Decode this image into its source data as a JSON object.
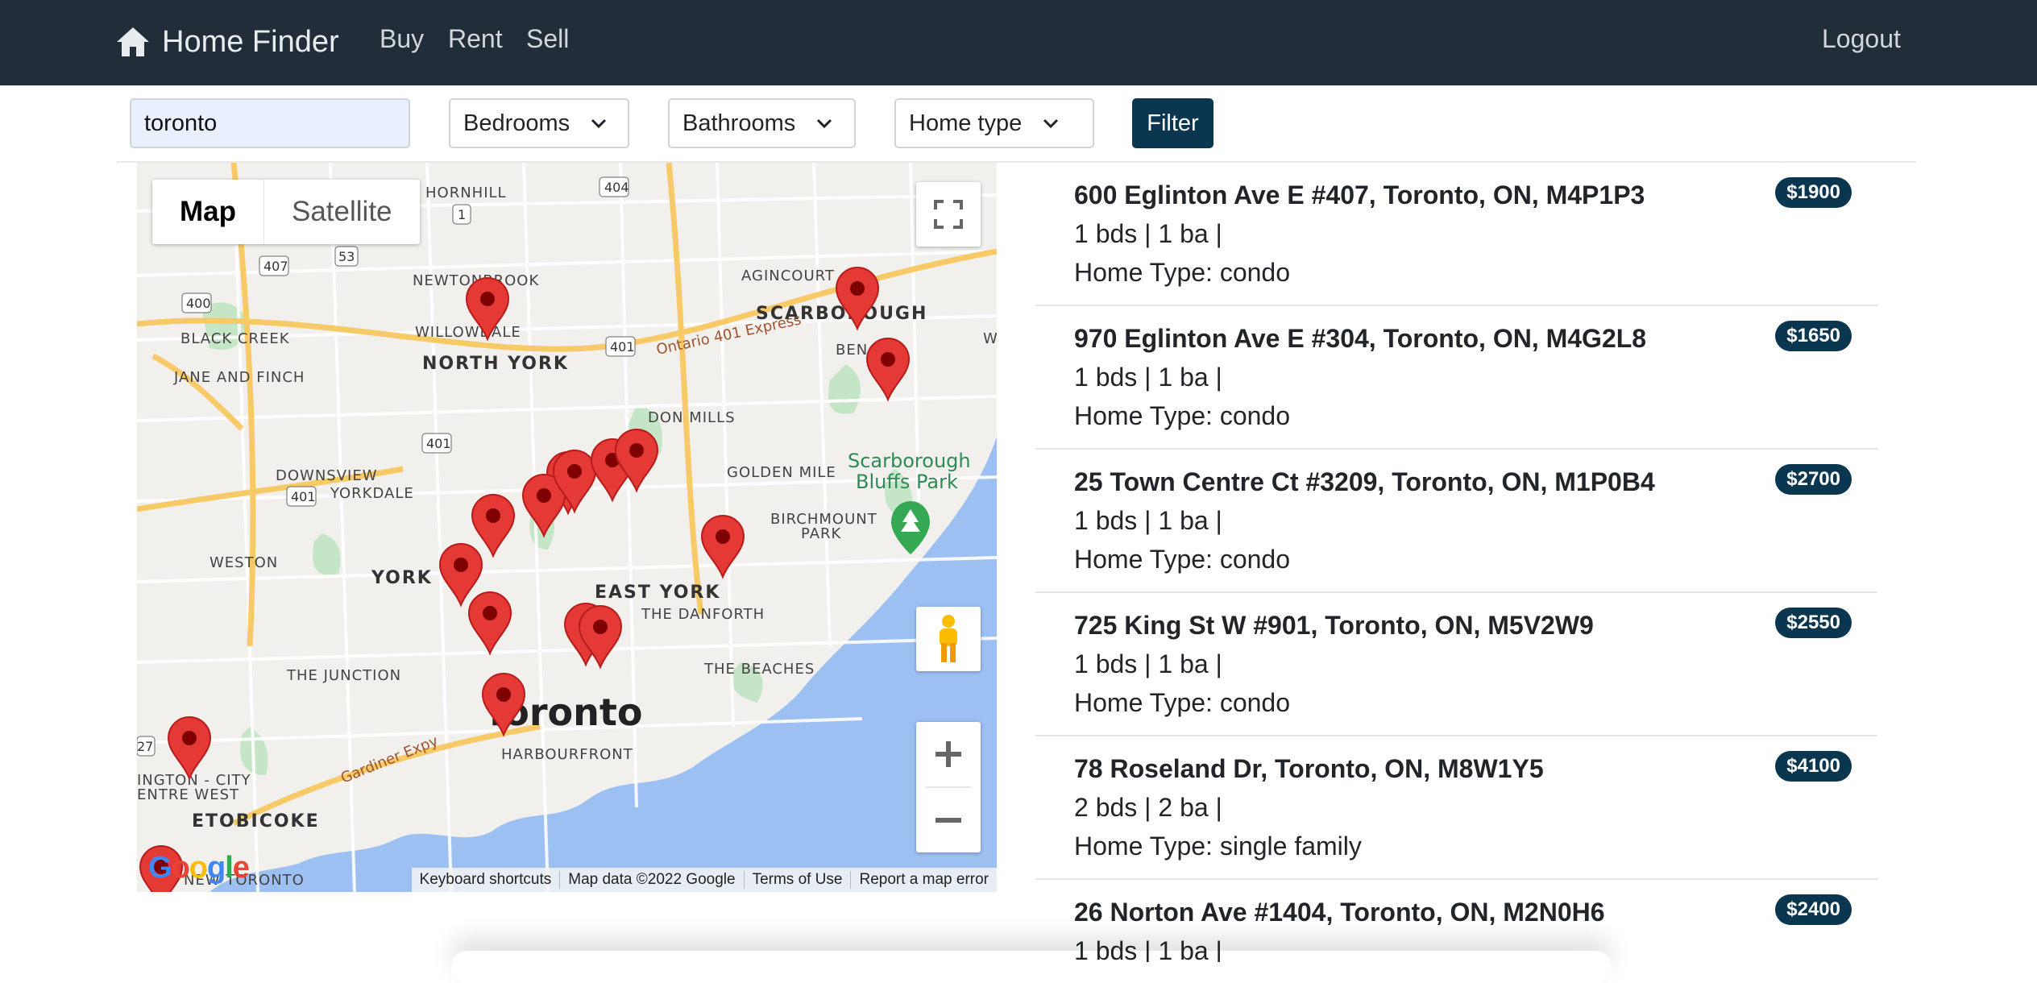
{
  "navbar": {
    "brand": "Home Finder",
    "links": [
      "Buy",
      "Rent",
      "Sell"
    ],
    "logout": "Logout"
  },
  "filters": {
    "search_value": "toronto",
    "bedrooms": "Bedrooms",
    "bathrooms": "Bathrooms",
    "home_type": "Home type",
    "filter_button": "Filter"
  },
  "map": {
    "type_map": "Map",
    "type_satellite": "Satellite",
    "footer": [
      "Keyboard shortcuts",
      "Map data ©2022 Google",
      "Terms of Use",
      "Report a map error"
    ],
    "labels": {
      "hornhill": "HORNHILL",
      "newtonbrook": "NEWTONBROOK",
      "agincourt": "AGINCOURT",
      "scarborough": "SCARBOROUGH",
      "willowdale": "WILLOWDALE",
      "black_creek": "BLACK CREEK",
      "north_york": "NORTH YORK",
      "jane_finch": "JANE AND FINCH",
      "ben": "BEN",
      "don_mills": "DON MILLS",
      "golden_mile": "GOLDEN MILE",
      "scar_bluffs_1": "Scarborough",
      "scar_bluffs_2": "Bluffs Park",
      "downsview": "DOWNSVIEW",
      "yorkdale": "YORKDALE",
      "birchmount_1": "BIRCHMOUNT",
      "birchmount_2": "PARK",
      "weston": "WESTON",
      "york": "YORK",
      "east_york": "EAST YORK",
      "the_danforth": "THE DANFORTH",
      "the_beaches": "THE BEACHES",
      "the_junction": "THE JUNCTION",
      "toronto": "Toronto",
      "harbourfront": "HARBOURFRONT",
      "islington": "INGTON - CITY",
      "centre_west": "ENTRE WEST",
      "etobicoke": "ETOBICOKE",
      "new_toronto": "NEW TORONTO",
      "gardiner": "Gardiner Expy",
      "hwy401": "Ontario 401 Express",
      "w": "W",
      "shield_404": "404",
      "shield_407": "407",
      "shield_53": "53",
      "shield_400": "400",
      "shield_401a": "401",
      "shield_401b": "401",
      "shield_401c": "401",
      "shield_1": "1",
      "shield_27": "27",
      "google": "Google"
    }
  },
  "listings": [
    {
      "address": "600 Eglinton Ave E #407, Toronto, ON, M4P1P3",
      "beds_baths": "1 bds | 1 ba |",
      "home_type": "Home Type: condo",
      "price": "$1900"
    },
    {
      "address": "970 Eglinton Ave E #304, Toronto, ON, M4G2L8",
      "beds_baths": "1 bds | 1 ba |",
      "home_type": "Home Type: condo",
      "price": "$1650"
    },
    {
      "address": "25 Town Centre Ct #3209, Toronto, ON, M1P0B4",
      "beds_baths": "1 bds | 1 ba |",
      "home_type": "Home Type: condo",
      "price": "$2700"
    },
    {
      "address": "725 King St W #901, Toronto, ON, M5V2W9",
      "beds_baths": "1 bds | 1 ba |",
      "home_type": "Home Type: condo",
      "price": "$2550"
    },
    {
      "address": "78 Roseland Dr, Toronto, ON, M8W1Y5",
      "beds_baths": "2 bds | 2 ba |",
      "home_type": "Home Type: single family",
      "price": "$4100"
    },
    {
      "address": "26 Norton Ave #1404, Toronto, ON, M2N0H6",
      "beds_baths": "1 bds | 1 ba |",
      "home_type": "",
      "price": "$2400"
    }
  ],
  "colors": {
    "navbar": "#212e3a",
    "primary": "#0b3650",
    "water": "#9dc0f2",
    "marker": "#e53935"
  }
}
